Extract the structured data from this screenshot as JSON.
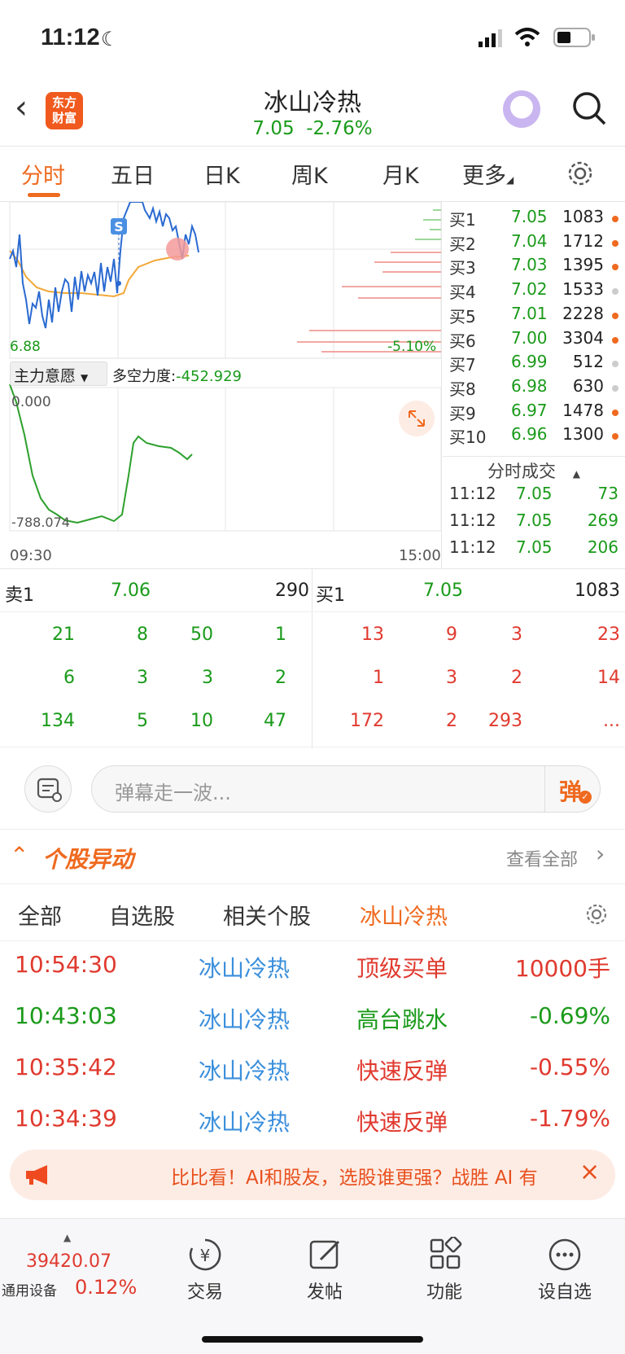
{
  "status_bar": {
    "time": "11:12"
  },
  "header": {
    "logo_line1": "东方",
    "logo_line2": "财富",
    "title": "冰山冷热",
    "price": "7.05",
    "change": "-2.76%"
  },
  "tabs": [
    "分时",
    "五日",
    "日K",
    "周K",
    "月K",
    "更多"
  ],
  "chart": {
    "low_label": "6.88",
    "pct_label": "-5.10%",
    "indicator_select": "主力意愿",
    "indicator_label": "多空力度:",
    "indicator_value": "-452.929",
    "sub_top": "0.000",
    "sub_bottom": "-788.074",
    "time_start": "09:30",
    "time_end": "15:00",
    "marker": "S"
  },
  "order_book": [
    {
      "label": "买1",
      "price": "7.05",
      "vol": "1083",
      "dot": "#ef6a1f"
    },
    {
      "label": "买2",
      "price": "7.04",
      "vol": "1712",
      "dot": "#ef6a1f"
    },
    {
      "label": "买3",
      "price": "7.03",
      "vol": "1395",
      "dot": "#ef6a1f"
    },
    {
      "label": "买4",
      "price": "7.02",
      "vol": "1533",
      "dot": "#cccccc"
    },
    {
      "label": "买5",
      "price": "7.01",
      "vol": "2228",
      "dot": "#ef6a1f"
    },
    {
      "label": "买6",
      "price": "7.00",
      "vol": "3304",
      "dot": "#ef6a1f"
    },
    {
      "label": "买7",
      "price": "6.99",
      "vol": "512",
      "dot": "#cccccc"
    },
    {
      "label": "买8",
      "price": "6.98",
      "vol": "630",
      "dot": "#cccccc"
    },
    {
      "label": "买9",
      "price": "6.97",
      "vol": "1478",
      "dot": "#ef6a1f"
    },
    {
      "label": "买10",
      "price": "6.96",
      "vol": "1300",
      "dot": "#ef6a1f"
    }
  ],
  "trades_header": "分时成交",
  "trades": [
    {
      "time": "11:12",
      "price": "7.05",
      "vol": "73"
    },
    {
      "time": "11:12",
      "price": "7.05",
      "vol": "269"
    },
    {
      "time": "11:12",
      "price": "7.05",
      "vol": "206"
    }
  ],
  "queue": {
    "sell_label": "卖1",
    "sell_price": "7.06",
    "sell_vol": "290",
    "buy_label": "买1",
    "buy_price": "7.05",
    "buy_vol": "1083",
    "sell_rows": [
      [
        "21",
        "8",
        "50",
        "1"
      ],
      [
        "6",
        "3",
        "3",
        "2"
      ],
      [
        "134",
        "5",
        "10",
        "47"
      ]
    ],
    "buy_rows": [
      [
        "13",
        "9",
        "3",
        "23"
      ],
      [
        "1",
        "3",
        "2",
        "14"
      ],
      [
        "172",
        "2",
        "293",
        "..."
      ]
    ]
  },
  "danmu": {
    "placeholder": "弹幕走一波...",
    "send": "弹"
  },
  "moves": {
    "title": "个股异动",
    "view_all": "查看全部",
    "filters": [
      "全部",
      "自选股",
      "相关个股",
      "冰山冷热"
    ],
    "rows": [
      {
        "time": "10:54:30",
        "name": "冰山冷热",
        "event": "顶级买单",
        "value": "10000手",
        "color": "red"
      },
      {
        "time": "10:43:03",
        "name": "冰山冷热",
        "event": "高台跳水",
        "value": "-0.69%",
        "color": "green"
      },
      {
        "time": "10:35:42",
        "name": "冰山冷热",
        "event": "快速反弹",
        "value": "-0.55%",
        "color": "red"
      },
      {
        "time": "10:34:39",
        "name": "冰山冷热",
        "event": "快速反弹",
        "value": "-1.79%",
        "color": "red"
      }
    ]
  },
  "banner": {
    "text": "比比看！AI和股友，选股谁更强？战胜 AI 有"
  },
  "bottom_nav": {
    "index_value": "39420.07",
    "index_name": "通用设备",
    "index_change": "0.12%",
    "items": [
      "交易",
      "发帖",
      "功能",
      "设自选"
    ]
  }
}
